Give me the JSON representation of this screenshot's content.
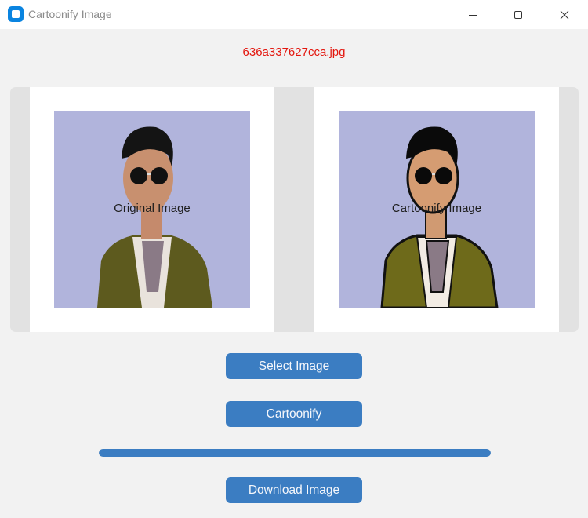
{
  "window": {
    "title": "Cartoonify Image",
    "icon": "app-icon",
    "controls": [
      "minimize-icon",
      "maximize-icon",
      "close-icon"
    ]
  },
  "file": {
    "name": "636a337627cca.jpg"
  },
  "images": {
    "original_label": "Original Image",
    "cartoon_label": "Cartoonify Image"
  },
  "buttons": {
    "select": "Select Image",
    "cartoonify": "Cartoonify",
    "download": "Download Image"
  },
  "progress": {
    "value": 1.0
  },
  "colors": {
    "accent": "#3b7dc2",
    "filename": "#e3160e",
    "photo_background": "#b1b4dc"
  }
}
